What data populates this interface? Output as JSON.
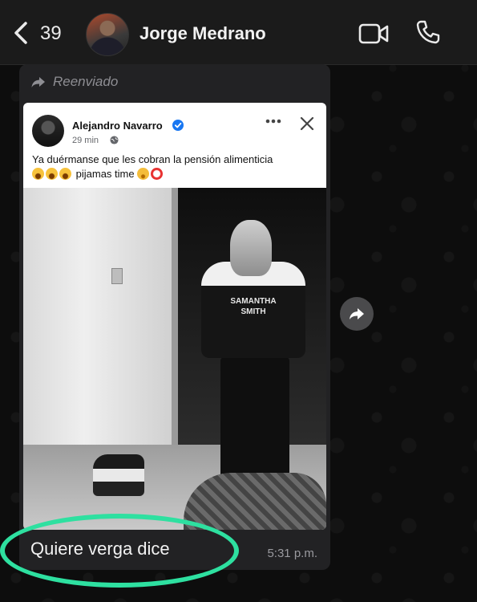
{
  "header": {
    "back_count": "39",
    "contact_name": "Jorge Medrano",
    "icons": [
      "chevron-left-icon",
      "video-call-icon",
      "phone-icon"
    ]
  },
  "message": {
    "forwarded_label": "Reenviado",
    "text": "Quiere verga dice",
    "time": "5:31 p.m."
  },
  "shared_post": {
    "author": "Alejandro Navarro",
    "time": "29 min",
    "text_line1": "Ya duérmanse que les cobran la pensión alimenticia",
    "text_line2": "pijamas time",
    "jersey_text": "SAMANTHA SMITH"
  },
  "colors": {
    "highlight": "#2ee0a0",
    "verified": "#1877f2"
  }
}
